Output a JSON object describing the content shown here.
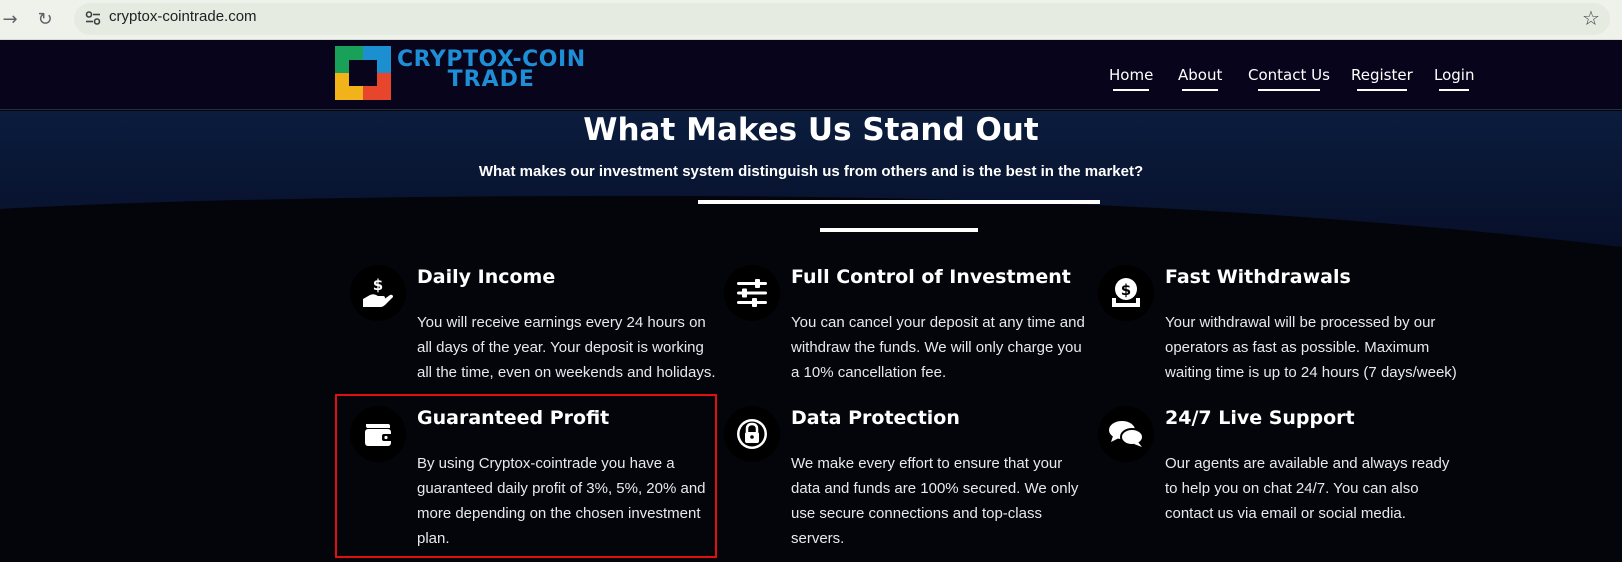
{
  "browser": {
    "back_icon": "arrow-right-icon",
    "reload_icon": "reload-icon",
    "site_info_icon": "tune-icon",
    "url": "cryptox-cointrade.com",
    "bookmark_icon": "star-icon"
  },
  "header": {
    "logo_line1": "CRYPTOX-COIN",
    "logo_line2": "TRADE",
    "nav": [
      {
        "label": "Home"
      },
      {
        "label": "About"
      },
      {
        "label": "Contact Us"
      },
      {
        "label": "Register"
      },
      {
        "label": "Login"
      }
    ]
  },
  "hero": {
    "title": "What Makes Us Stand Out",
    "subtitle": "What makes our investment system distinguish us from others and is the best in the market?"
  },
  "features": [
    {
      "icon": "hand-dollar-icon",
      "title": "Daily Income",
      "desc": "You will receive earnings every 24 hours on all days of the year. Your deposit is working all the time, even on weekends and holidays."
    },
    {
      "icon": "sliders-icon",
      "title": "Full Control of Investment",
      "desc": "You can cancel your deposit at any time and withdraw the funds. We will only charge you a 10% cancellation fee."
    },
    {
      "icon": "money-withdraw-icon",
      "title": "Fast Withdrawals",
      "desc": "Your withdrawal will be processed by our operators as fast as possible. Maximum waiting time is up to 24 hours (7 days/week)"
    },
    {
      "icon": "wallet-icon",
      "title": "Guaranteed Profit",
      "desc": "By using Cryptox-cointrade you have a guaranteed daily profit of 3%, 5%, 20% and more depending on the chosen investment plan."
    },
    {
      "icon": "lock-icon",
      "title": "Data Protection",
      "desc": "We make every effort to ensure that your data and funds are 100% secured. We only use secure connections and top-class servers."
    },
    {
      "icon": "comments-icon",
      "title": "24/7 Live Support",
      "desc": "Our agents are available and always ready to help you on chat 24/7. You can also contact us via email or social media."
    }
  ],
  "colors": {
    "header_bg": "#07041b",
    "page_bg": "#03050b",
    "hero_bg": "#0a1835",
    "logo_blue": "#1e8fd6",
    "highlight": "#e01010"
  }
}
